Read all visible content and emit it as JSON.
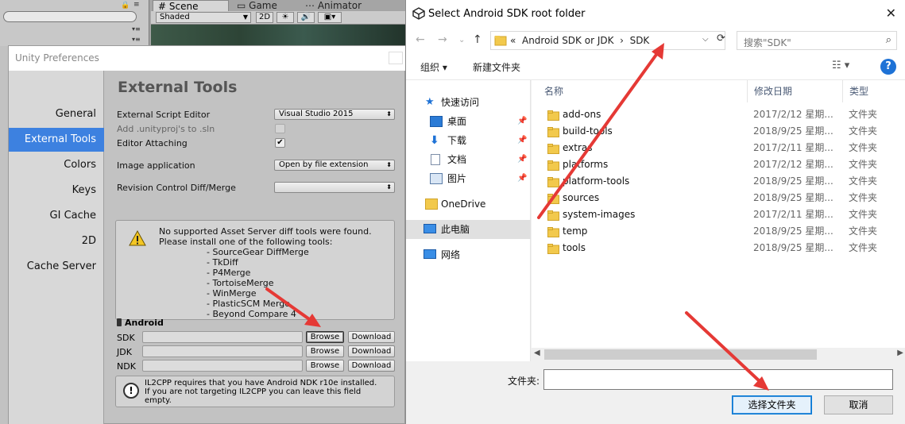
{
  "editor": {
    "tabs": {
      "scene": "# Scene",
      "game": "Game",
      "animator": "Animator"
    },
    "scene_toolbar": {
      "shaded": "Shaded",
      "mode_2d": "2D"
    }
  },
  "prefs": {
    "window_title": "Unity Preferences",
    "sidebar": [
      "General",
      "External Tools",
      "Colors",
      "Keys",
      "GI Cache",
      "2D",
      "Cache Server"
    ],
    "active_item": "External Tools",
    "section_title": "External Tools",
    "external_script_editor": {
      "label": "External Script Editor",
      "value": "Visual Studio 2015"
    },
    "add_unityproj": {
      "label": "Add .unityproj's to .sln",
      "checked": false
    },
    "editor_attaching": {
      "label": "Editor Attaching",
      "checked": true
    },
    "image_application": {
      "label": "Image application",
      "value": "Open by file extension"
    },
    "revision_control": {
      "label": "Revision Control Diff/Merge",
      "value": ""
    },
    "warning": {
      "text": "No supported Asset Server diff tools were found.\nPlease install one of the following tools:",
      "tools": [
        "- SourceGear DiffMerge",
        "- TkDiff",
        "- P4Merge",
        "- TortoiseMerge",
        "- WinMerge",
        "- PlasticSCM Merge",
        "- Beyond Compare 4"
      ]
    },
    "android": {
      "header": "Android",
      "rows": [
        {
          "label": "SDK",
          "browse": "Browse",
          "download": "Download"
        },
        {
          "label": "JDK",
          "browse": "Browse",
          "download": "Download"
        },
        {
          "label": "NDK",
          "browse": "Browse",
          "download": "Download"
        }
      ],
      "il2cpp_note": "IL2CPP requires that you have Android NDK r10e installed.\nIf you are not targeting IL2CPP you can leave this field\nempty."
    }
  },
  "dialog": {
    "title": "Select Android SDK root folder",
    "address": {
      "prefix": "«",
      "crumbs": [
        "Android SDK or JDK",
        "SDK"
      ],
      "separator": "›"
    },
    "search_placeholder": "搜索\"SDK\"",
    "toolbar": {
      "organize": "组织 ▾",
      "new_folder": "新建文件夹"
    },
    "nav": [
      {
        "label": "快速访问",
        "icon": "star-icon"
      },
      {
        "label": "桌面",
        "icon": "desktop-icon",
        "pinned": true
      },
      {
        "label": "下载",
        "icon": "download-icon",
        "pinned": true
      },
      {
        "label": "文档",
        "icon": "document-icon",
        "pinned": true
      },
      {
        "label": "图片",
        "icon": "picture-icon",
        "pinned": true
      },
      {
        "label": "OneDrive",
        "icon": "folder-icon"
      },
      {
        "label": "此电脑",
        "icon": "computer-icon",
        "selected": true
      },
      {
        "label": "网络",
        "icon": "network-icon"
      }
    ],
    "columns": {
      "name": "名称",
      "date": "修改日期",
      "type": "类型"
    },
    "files": [
      {
        "name": "add-ons",
        "date": "2017/2/12 星期...",
        "type": "文件夹"
      },
      {
        "name": "build-tools",
        "date": "2018/9/25 星期...",
        "type": "文件夹"
      },
      {
        "name": "extras",
        "date": "2017/2/11 星期...",
        "type": "文件夹"
      },
      {
        "name": "platforms",
        "date": "2017/2/12 星期...",
        "type": "文件夹"
      },
      {
        "name": "platform-tools",
        "date": "2018/9/25 星期...",
        "type": "文件夹"
      },
      {
        "name": "sources",
        "date": "2018/9/25 星期...",
        "type": "文件夹"
      },
      {
        "name": "system-images",
        "date": "2017/2/11 星期...",
        "type": "文件夹"
      },
      {
        "name": "temp",
        "date": "2018/9/25 星期...",
        "type": "文件夹"
      },
      {
        "name": "tools",
        "date": "2018/9/25 星期...",
        "type": "文件夹"
      }
    ],
    "footer": {
      "folder_label": "文件夹:",
      "folder_value": "",
      "select_button": "选择文件夹",
      "cancel_button": "取消"
    }
  },
  "colors": {
    "accent": "#3d81e0",
    "arrow": "#e53935",
    "folder": "#f2c94c",
    "help": "#1e72d6"
  }
}
